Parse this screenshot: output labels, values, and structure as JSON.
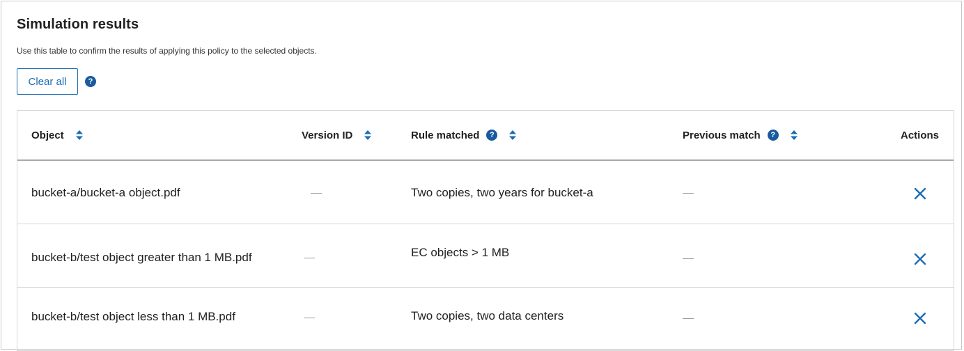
{
  "header": {
    "title": "Simulation results",
    "description": "Use this table to confirm the results of applying this policy to the selected objects."
  },
  "toolbar": {
    "clear_all_label": "Clear all",
    "help_glyph": "?"
  },
  "table": {
    "columns": {
      "object": "Object",
      "version_id": "Version ID",
      "rule_matched": "Rule matched",
      "previous_match": "Previous match",
      "actions": "Actions"
    },
    "rows": [
      {
        "object": "bucket-a/bucket-a object.pdf",
        "version_id": "—",
        "rule_matched": "Two copies, two years for bucket-a",
        "previous_match": "—"
      },
      {
        "object": "bucket-b/test object greater than 1 MB.pdf",
        "version_id": "—",
        "rule_matched": "EC objects > 1 MB",
        "previous_match": "—"
      },
      {
        "object": "bucket-b/test object less than 1 MB.pdf",
        "version_id": "—",
        "rule_matched": "Two copies, two data centers",
        "previous_match": "—"
      }
    ]
  },
  "colors": {
    "accent": "#1a6db5",
    "help_icon": "#1a5aa0",
    "remove_icon": "#1a6db5"
  },
  "icons": {
    "sort": "sort-icon",
    "help": "help-icon",
    "remove": "close-icon"
  }
}
